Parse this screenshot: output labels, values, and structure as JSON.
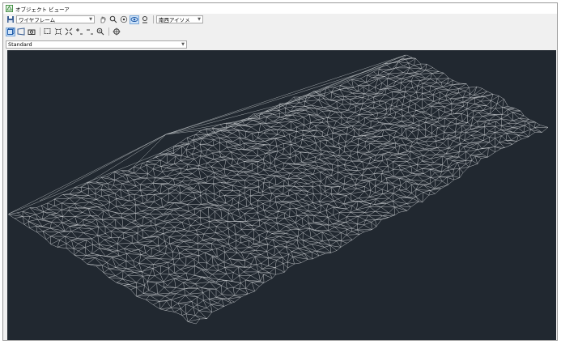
{
  "window": {
    "title": "オブジェクト ビューア"
  },
  "toolbar1": {
    "visual_style": "ワイヤフレーム",
    "view_direction": "南西アイソメ"
  },
  "toolbar3": {
    "view_preset": "Standard"
  },
  "colors": {
    "viewport_bg": "#212830",
    "wireframe": "#c7cbce",
    "active_button": "#cfe3f8"
  }
}
